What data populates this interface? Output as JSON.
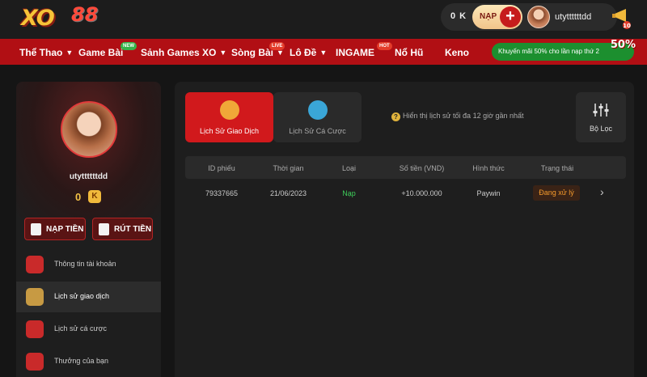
{
  "header": {
    "logo": "XO88",
    "balance": "0 K",
    "nap_label": "NẠP",
    "username": "utyttttttdd"
  },
  "nav": {
    "items": [
      {
        "label": "Thể Thao",
        "chevron": true
      },
      {
        "label": "Game Bài",
        "chevron": false,
        "tag": "NEW"
      },
      {
        "label": "Sảnh Games XO",
        "chevron": true
      },
      {
        "label": "Sòng Bài",
        "chevron": true,
        "tag": "LIVE"
      },
      {
        "label": "Lô Đề",
        "chevron": true
      },
      {
        "label": "INGAME",
        "chevron": false,
        "tag": "HOT"
      },
      {
        "label": "Nổ Hũ",
        "chevron": false
      },
      {
        "label": "Keno",
        "chevron": false
      }
    ],
    "promo_text": "Khuyến mãi 50% cho lần nạp thứ 2",
    "promo_badge": "50%"
  },
  "sidebar": {
    "username": "utyttttttdd",
    "points": "0",
    "point_unit": "K",
    "deposit_label": "NẠP TIỀN",
    "withdraw_label": "RÚT TIỀN",
    "menu": [
      {
        "label": "Thông tin tài khoản",
        "icon": "account-icon",
        "active": false
      },
      {
        "label": "Lịch sử giao dịch",
        "icon": "wallet-icon",
        "active": true
      },
      {
        "label": "Lịch sử cá cược",
        "icon": "money-bag-icon",
        "active": false
      },
      {
        "label": "Thưởng của bạn",
        "icon": "gift-icon",
        "active": false
      }
    ]
  },
  "main": {
    "tabs": [
      {
        "label": "Lịch Sử Giao Dịch",
        "active": true
      },
      {
        "label": "Lịch Sử Cá Cược",
        "active": false
      }
    ],
    "hint": "Hiển thị lịch sử tối đa 12 giờ gần nhất",
    "filter_label": "Bộ Lọc",
    "table": {
      "headers": [
        "ID phiếu",
        "Thời gian",
        "Loại",
        "Số tiền (VND)",
        "Hình thức",
        "Trạng thái"
      ],
      "rows": [
        {
          "id": "79337665",
          "time": "21/06/2023",
          "type": "Nạp",
          "amount": "+10.000.000",
          "method": "Paywin",
          "status": "Đang xử lý"
        }
      ]
    }
  },
  "colors": {
    "brand_red": "#b10f14",
    "accent_gold": "#f2c146",
    "success_green": "#3ecf5a",
    "pending_orange": "#f59a2c"
  }
}
